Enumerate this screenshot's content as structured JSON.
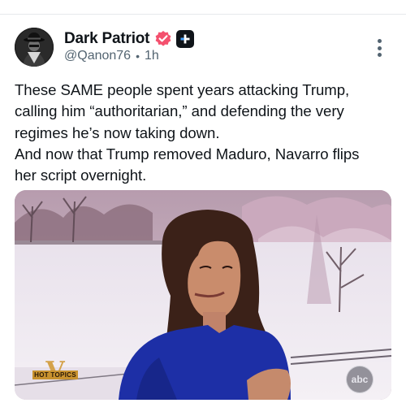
{
  "author": {
    "display_name": "Dark Patriot",
    "handle": "@Qanon76",
    "separator": "•",
    "time_ago": "1h",
    "verified_icon": "verified-badge-icon",
    "app_icon": "plus-badge-icon"
  },
  "menu": {
    "icon": "more-vertical-icon"
  },
  "post": {
    "lines": [
      "These SAME people spent years attacking Trump,",
      "calling him “authoritarian,” and defending the very",
      "regimes he’s now taking down.",
      "And now that Trump removed Maduro, Navarro flips",
      "her script overnight."
    ]
  },
  "media": {
    "show_logo_letter": "V",
    "show_logo_label": "HOT TOPICS",
    "network_logo": "abc"
  },
  "colors": {
    "text": "#0f1419",
    "secondary": "#536471",
    "verified": "#f4506e",
    "dress": "#1d2fa6"
  }
}
